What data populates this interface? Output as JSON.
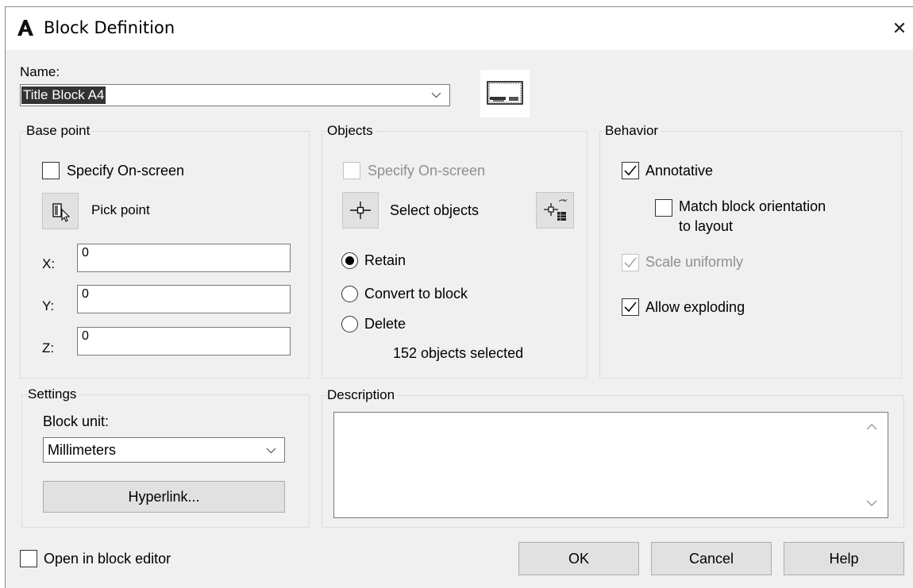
{
  "window": {
    "title": "Block Definition",
    "close_glyph": "✕"
  },
  "name": {
    "label": "Name:",
    "value": "Title Block A4"
  },
  "base_point": {
    "legend": "Base point",
    "specify_label": "Specify On-screen",
    "specify_checked": false,
    "pick_label": "Pick point",
    "x_label": "X:",
    "x_value": "0",
    "y_label": "Y:",
    "y_value": "0",
    "z_label": "Z:",
    "z_value": "0"
  },
  "objects": {
    "legend": "Objects",
    "specify_label": "Specify On-screen",
    "select_label": "Select objects",
    "retain_label": "Retain",
    "convert_label": "Convert to block",
    "delete_label": "Delete",
    "selected_option": "Retain",
    "status": "152 objects selected"
  },
  "behavior": {
    "legend": "Behavior",
    "annotative_label": "Annotative",
    "annotative_checked": true,
    "match_line1": "Match block orientation",
    "match_line2": "to layout",
    "match_checked": false,
    "scale_label": "Scale uniformly",
    "scale_checked": true,
    "scale_disabled": true,
    "exploding_label": "Allow exploding",
    "exploding_checked": true
  },
  "settings": {
    "legend": "Settings",
    "unit_label": "Block unit:",
    "unit_value": "Millimeters",
    "hyperlink_label": "Hyperlink..."
  },
  "description": {
    "legend": "Description",
    "value": ""
  },
  "footer": {
    "open_editor_label": "Open in block editor",
    "open_editor_checked": false,
    "ok_label": "OK",
    "cancel_label": "Cancel",
    "help_label": "Help"
  },
  "icons": {
    "app_logo": "autocad-a-logo",
    "close": "close-icon",
    "dropdown": "chevron-down-icon",
    "pick_point": "pick-point-icon",
    "select_objects": "crosshair-icon",
    "quick_select": "quick-select-icon",
    "preview": "block-preview-thumbnail"
  },
  "colors": {
    "dialog_bg": "#f0f0f0",
    "button_bg": "#e1e1e1",
    "selection": "#333333"
  }
}
